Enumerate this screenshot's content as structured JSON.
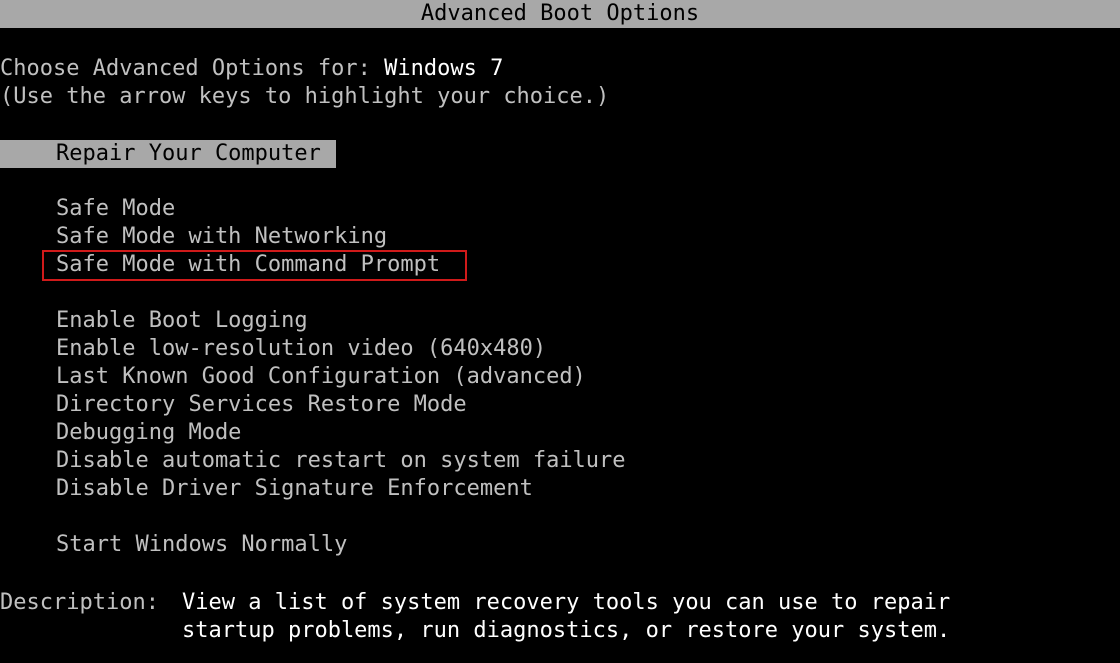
{
  "title": "Advanced Boot Options",
  "header": {
    "prompt": "Choose Advanced Options for: ",
    "os_name": "Windows 7",
    "instruction": "(Use the arrow keys to highlight your choice.)"
  },
  "selected_option": "Repair Your Computer",
  "options": [
    "Safe Mode",
    "Safe Mode with Networking",
    "Safe Mode with Command Prompt",
    "Enable Boot Logging",
    "Enable low-resolution video (640x480)",
    "Last Known Good Configuration (advanced)",
    "Directory Services Restore Mode",
    "Debugging Mode",
    "Disable automatic restart on system failure",
    "Disable Driver Signature Enforcement",
    "Start Windows Normally"
  ],
  "annotated_option": "Safe Mode with Command Prompt",
  "annotation_color": "#d01a1a",
  "description": {
    "label": "Description:",
    "line1": "View a list of system recovery tools you can use to repair",
    "line2": "startup problems, run diagnostics, or restore your system."
  }
}
